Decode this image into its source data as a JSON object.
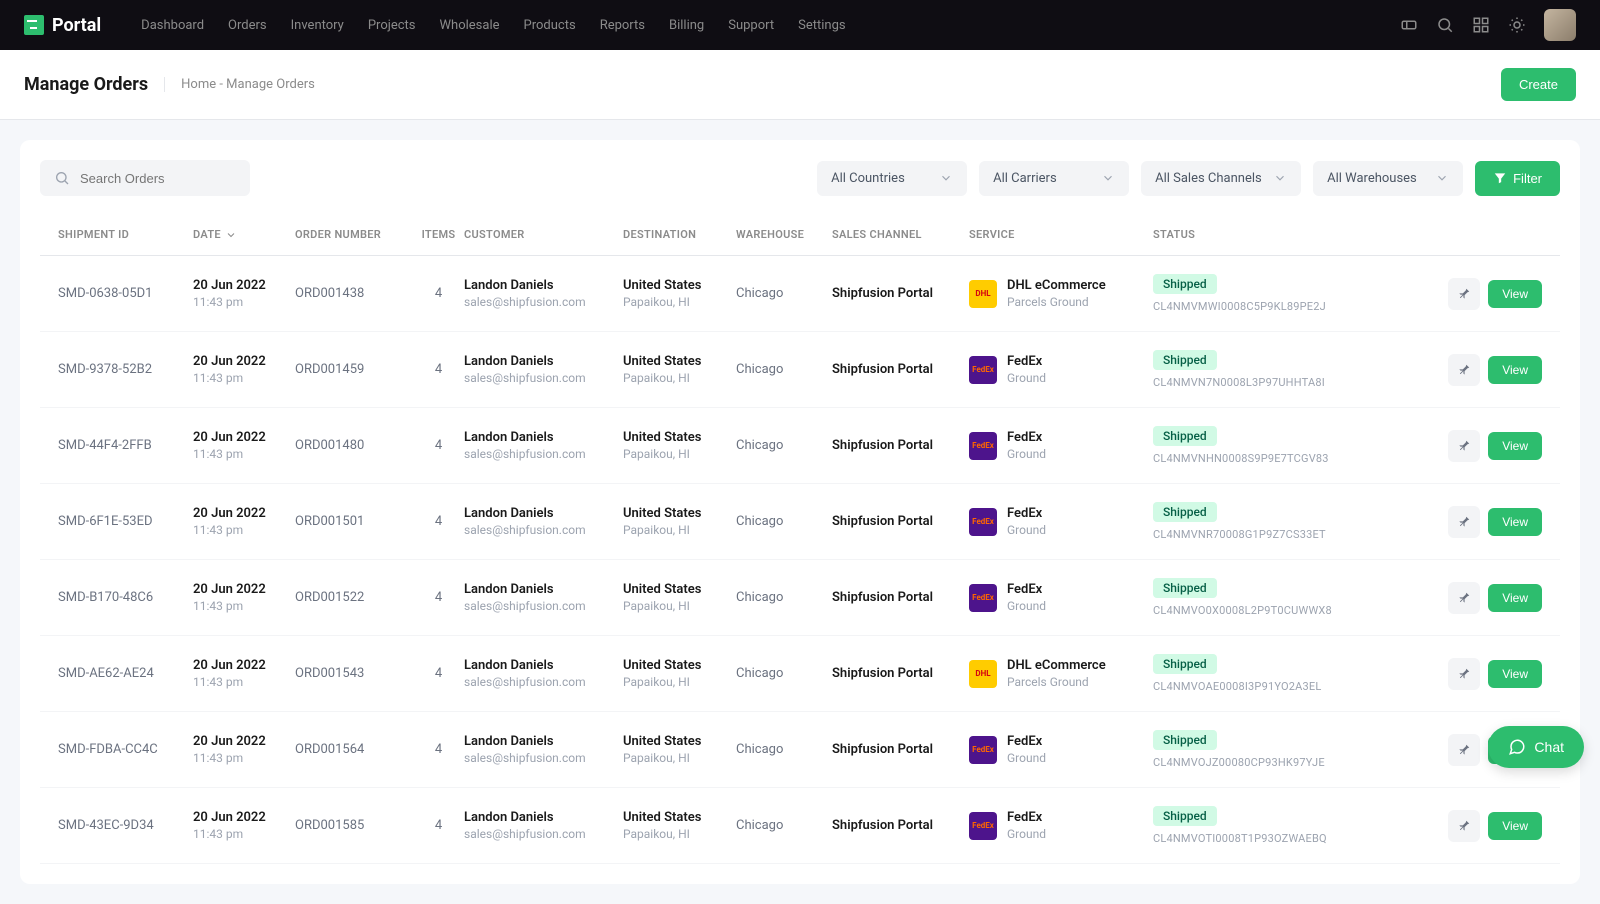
{
  "brand": "Portal",
  "nav": [
    "Dashboard",
    "Orders",
    "Inventory",
    "Projects",
    "Wholesale",
    "Products",
    "Reports",
    "Billing",
    "Support",
    "Settings"
  ],
  "page": {
    "title": "Manage Orders",
    "breadcrumb_home": "Home",
    "breadcrumb_sep": "-",
    "breadcrumb_current": "Manage Orders",
    "create_label": "Create"
  },
  "toolbar": {
    "search_placeholder": "Search Orders",
    "countries": "All Countries",
    "carriers": "All Carriers",
    "channels": "All Sales Channels",
    "warehouses": "All Warehouses",
    "filter_label": "Filter"
  },
  "columns": {
    "shipment_id": "SHIPMENT ID",
    "date": "DATE",
    "order_number": "ORDER NUMBER",
    "items": "ITEMS",
    "customer": "CUSTOMER",
    "destination": "DESTINATION",
    "warehouse": "WAREHOUSE",
    "sales_channel": "SALES CHANNEL",
    "service": "SERVICE",
    "status": "STATUS"
  },
  "actions": {
    "view": "View"
  },
  "chat_label": "Chat",
  "rows": [
    {
      "shipment_id": "SMD-0638-05D1",
      "date": "20 Jun 2022",
      "time": "11:43 pm",
      "order_number": "ORD001438",
      "items": "4",
      "customer": "Landon Daniels",
      "email": "sales@shipfusion.com",
      "country": "United States",
      "city": "Papaikou, HI",
      "warehouse": "Chicago",
      "channel": "Shipfusion Portal",
      "carrier": "dhl",
      "service": "DHL eCommerce",
      "service_sub": "Parcels Ground",
      "status": "Shipped",
      "tracking": "CL4NMVMWI0008C5P9KL89PE2J"
    },
    {
      "shipment_id": "SMD-9378-52B2",
      "date": "20 Jun 2022",
      "time": "11:43 pm",
      "order_number": "ORD001459",
      "items": "4",
      "customer": "Landon Daniels",
      "email": "sales@shipfusion.com",
      "country": "United States",
      "city": "Papaikou, HI",
      "warehouse": "Chicago",
      "channel": "Shipfusion Portal",
      "carrier": "fedex",
      "service": "FedEx",
      "service_sub": "Ground",
      "status": "Shipped",
      "tracking": "CL4NMVN7N0008L3P97UHHTA8I"
    },
    {
      "shipment_id": "SMD-44F4-2FFB",
      "date": "20 Jun 2022",
      "time": "11:43 pm",
      "order_number": "ORD001480",
      "items": "4",
      "customer": "Landon Daniels",
      "email": "sales@shipfusion.com",
      "country": "United States",
      "city": "Papaikou, HI",
      "warehouse": "Chicago",
      "channel": "Shipfusion Portal",
      "carrier": "fedex",
      "service": "FedEx",
      "service_sub": "Ground",
      "status": "Shipped",
      "tracking": "CL4NMVNHN0008S9P9E7TCGV83"
    },
    {
      "shipment_id": "SMD-6F1E-53ED",
      "date": "20 Jun 2022",
      "time": "11:43 pm",
      "order_number": "ORD001501",
      "items": "4",
      "customer": "Landon Daniels",
      "email": "sales@shipfusion.com",
      "country": "United States",
      "city": "Papaikou, HI",
      "warehouse": "Chicago",
      "channel": "Shipfusion Portal",
      "carrier": "fedex",
      "service": "FedEx",
      "service_sub": "Ground",
      "status": "Shipped",
      "tracking": "CL4NMVNR70008G1P9Z7CS33ET"
    },
    {
      "shipment_id": "SMD-B170-48C6",
      "date": "20 Jun 2022",
      "time": "11:43 pm",
      "order_number": "ORD001522",
      "items": "4",
      "customer": "Landon Daniels",
      "email": "sales@shipfusion.com",
      "country": "United States",
      "city": "Papaikou, HI",
      "warehouse": "Chicago",
      "channel": "Shipfusion Portal",
      "carrier": "fedex",
      "service": "FedEx",
      "service_sub": "Ground",
      "status": "Shipped",
      "tracking": "CL4NMVO0X0008L2P9T0CUWWX8"
    },
    {
      "shipment_id": "SMD-AE62-AE24",
      "date": "20 Jun 2022",
      "time": "11:43 pm",
      "order_number": "ORD001543",
      "items": "4",
      "customer": "Landon Daniels",
      "email": "sales@shipfusion.com",
      "country": "United States",
      "city": "Papaikou, HI",
      "warehouse": "Chicago",
      "channel": "Shipfusion Portal",
      "carrier": "dhl",
      "service": "DHL eCommerce",
      "service_sub": "Parcels Ground",
      "status": "Shipped",
      "tracking": "CL4NMVOAE0008I3P91YO2A3EL"
    },
    {
      "shipment_id": "SMD-FDBA-CC4C",
      "date": "20 Jun 2022",
      "time": "11:43 pm",
      "order_number": "ORD001564",
      "items": "4",
      "customer": "Landon Daniels",
      "email": "sales@shipfusion.com",
      "country": "United States",
      "city": "Papaikou, HI",
      "warehouse": "Chicago",
      "channel": "Shipfusion Portal",
      "carrier": "fedex",
      "service": "FedEx",
      "service_sub": "Ground",
      "status": "Shipped",
      "tracking": "CL4NMVOJZ00080CP93HK97YJE"
    },
    {
      "shipment_id": "SMD-43EC-9D34",
      "date": "20 Jun 2022",
      "time": "11:43 pm",
      "order_number": "ORD001585",
      "items": "4",
      "customer": "Landon Daniels",
      "email": "sales@shipfusion.com",
      "country": "United States",
      "city": "Papaikou, HI",
      "warehouse": "Chicago",
      "channel": "Shipfusion Portal",
      "carrier": "fedex",
      "service": "FedEx",
      "service_sub": "Ground",
      "status": "Shipped",
      "tracking": "CL4NMVOTI0008T1P93OZWAEBQ"
    }
  ]
}
